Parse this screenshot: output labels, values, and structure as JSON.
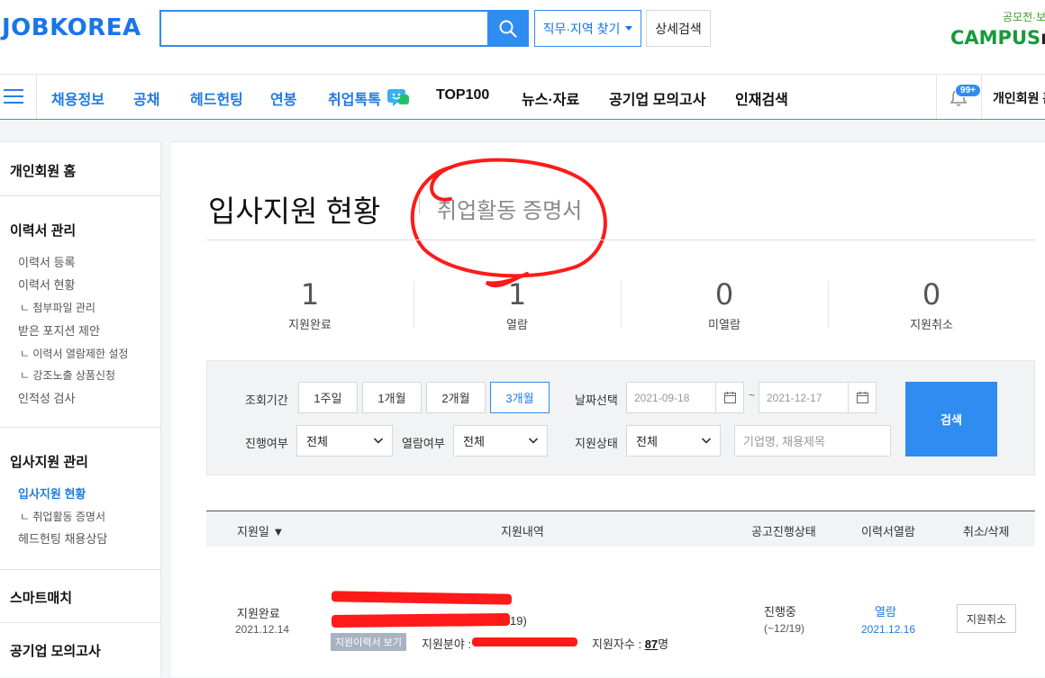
{
  "header": {
    "logo": "JOBKOREA",
    "search_placeholder": "",
    "job_region_btn": "직무·지역 찾기",
    "detail_search_btn": "상세검색",
    "promo_top": "공모전·보",
    "promo_logo_main": "CAMPUS",
    "promo_logo_tail": "m"
  },
  "nav": {
    "items": [
      "채용정보",
      "공채",
      "헤드헌팅",
      "연봉",
      "취업톡톡",
      "TOP100",
      "뉴스·자료",
      "공기업 모의고사",
      "인재검색"
    ],
    "bell_badge": "99+",
    "member_home": "개인회원 홈"
  },
  "sidebar": {
    "home": "개인회원 홈",
    "resume_title": "이력서 관리",
    "resume_items": [
      "이력서 등록",
      "이력서 현황",
      "ㄴ 첨부파일 관리",
      "받은 포지션 제안",
      "ㄴ 이력서 열람제한 설정",
      "ㄴ 강조노출 상품신청",
      "인적성 검사"
    ],
    "apply_title": "입사지원 관리",
    "apply_items": [
      "입사지원 현황",
      "ㄴ 취업활동 증명서",
      "헤드헌팅 채용상담"
    ],
    "smart_match": "스마트매치",
    "public_mock": "공기업 모의고사"
  },
  "main": {
    "title": "입사지원 현황",
    "cert_link": "취업활동 증명서",
    "stats": [
      {
        "num": "1",
        "label": "지원완료"
      },
      {
        "num": "1",
        "label": "열람"
      },
      {
        "num": "0",
        "label": "미열람"
      },
      {
        "num": "0",
        "label": "지원취소"
      }
    ],
    "filter": {
      "period_label": "조회기간",
      "periods": [
        "1주일",
        "1개월",
        "2개월",
        "3개월"
      ],
      "date_label": "날짜선택",
      "date_from": "2021-09-18",
      "tilde": "~",
      "date_to": "2021-12-17",
      "progress_label": "진행여부",
      "progress_value": "전체",
      "read_label": "열람여부",
      "read_value": "전체",
      "status_label": "지원상태",
      "status_value": "전체",
      "keyword_placeholder": "기업명, 채용제목",
      "search_btn": "검색"
    },
    "table": {
      "headers": [
        "지원일 ▼",
        "지원내역",
        "공고진행상태",
        "이력서열람",
        "취소/삭제"
      ],
      "row": {
        "status": "지원완료",
        "date": "2021.12.14",
        "suffix": "19)",
        "resume_badge": "지원이력서 보기",
        "field_label": "지원분야 :",
        "apply_count_label": "지원자수 :",
        "apply_count": "87",
        "apply_count_unit": "명",
        "progress": "진행중",
        "progress_sub": "(~12/19)",
        "read": "열람",
        "read_date": "2021.12.16",
        "cancel_btn": "지원취소"
      }
    }
  },
  "colors": {
    "brand_blue": "#2f8cf0",
    "annotation_red": "#ff1a1a"
  }
}
